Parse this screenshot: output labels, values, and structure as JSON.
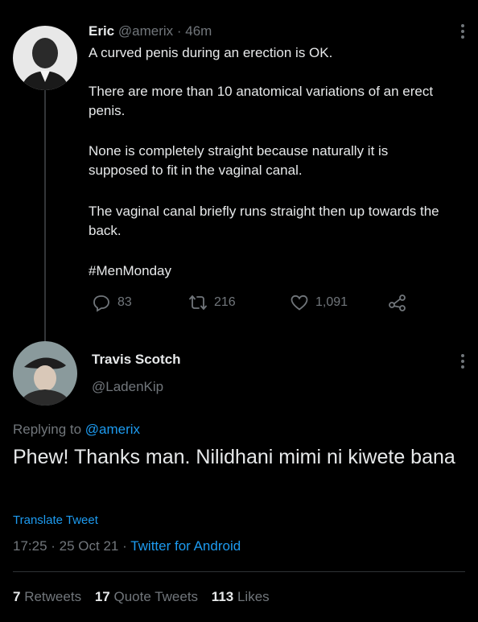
{
  "tweet": {
    "author_name": "Eric",
    "author_handle": "@amerix",
    "time_sep": " · ",
    "age": "46m",
    "paragraphs": [
      "A curved penis during an erection is OK.",
      "There are more than 10 anatomical variations of an erect penis.",
      "None is completely straight because naturally it is supposed to fit in the vaginal canal.",
      "The vaginal canal briefly runs straight then up towards the back."
    ],
    "hashtag": "#MenMonday",
    "replies": "83",
    "retweets": "216",
    "likes": "1,091",
    "icons": {
      "reply": "reply-icon",
      "retweet": "retweet-icon",
      "like": "heart-icon",
      "share": "share-icon",
      "more": "more-icon"
    }
  },
  "reply": {
    "author_name": "Travis Scotch",
    "author_handle": "@LadenKip",
    "replying_prefix": "Replying to ",
    "replying_handle": "@amerix",
    "text": "Phew! Thanks man. Nilidhani mimi ni kiwete bana",
    "translate_label": "Translate Tweet",
    "time": "17:25",
    "dot1": " · ",
    "date": "25 Oct 21",
    "dot2": " · ",
    "client": "Twitter for Android"
  },
  "stats": {
    "retweets_count": "7",
    "retweets_label": "Retweets",
    "quotes_count": "17",
    "quotes_label": "Quote Tweets",
    "likes_count": "113",
    "likes_label": "Likes"
  },
  "colors": {
    "background": "#000000",
    "accent": "#1d9bf0",
    "muted": "#71767b",
    "text": "#e7e9ea"
  }
}
